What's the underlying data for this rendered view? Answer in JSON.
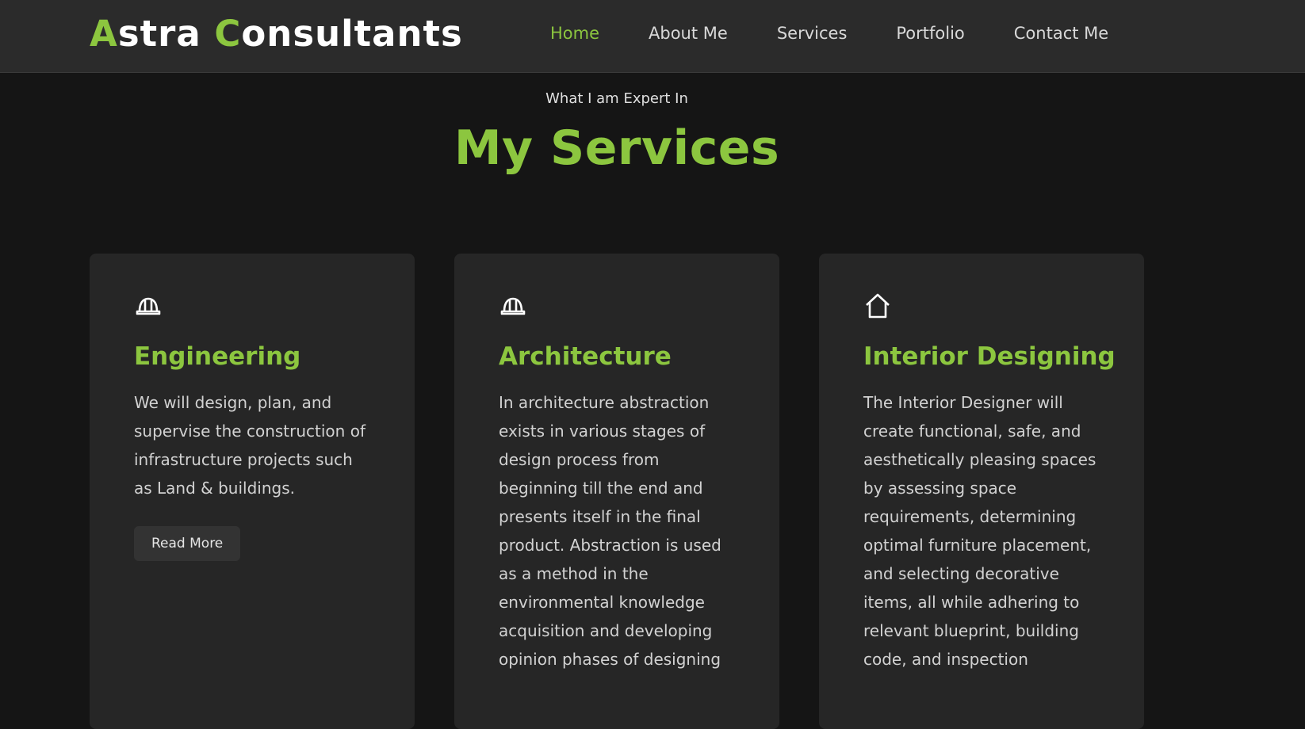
{
  "brand": {
    "first_initial": "A",
    "first_rest": "stra ",
    "second_initial": "C",
    "second_rest": "onsultants"
  },
  "nav": {
    "items": [
      {
        "label": "Home",
        "active": true
      },
      {
        "label": "About Me",
        "active": false
      },
      {
        "label": "Services",
        "active": false
      },
      {
        "label": "Portfolio",
        "active": false
      },
      {
        "label": "Contact Me",
        "active": false
      }
    ]
  },
  "section": {
    "subtitle": "What I am Expert In",
    "title": "My Services"
  },
  "cards": [
    {
      "icon": "hard-hat-icon",
      "title": "Engineering",
      "text": "We will design, plan, and supervise the construction of infrastructure projects such as Land & buildings.",
      "button": "Read More"
    },
    {
      "icon": "hard-hat-icon",
      "title": "Architecture",
      "text": "In architecture abstraction exists in various stages of design process from beginning till the end and presents itself in the final product. Abstraction is used as a method in the environmental knowledge acquisition and developing opinion phases of designing"
    },
    {
      "icon": "house-icon",
      "title": "Interior Designing",
      "text": "The Interior Designer will create functional, safe, and aesthetically pleasing spaces by assessing space requirements, determining optimal furniture placement, and selecting decorative items, all while adhering to relevant blueprint, building code, and inspection"
    }
  ],
  "colors": {
    "accent": "#8cc63f",
    "background": "#151515",
    "navbar": "#2b2b2b",
    "card": "#262626"
  }
}
